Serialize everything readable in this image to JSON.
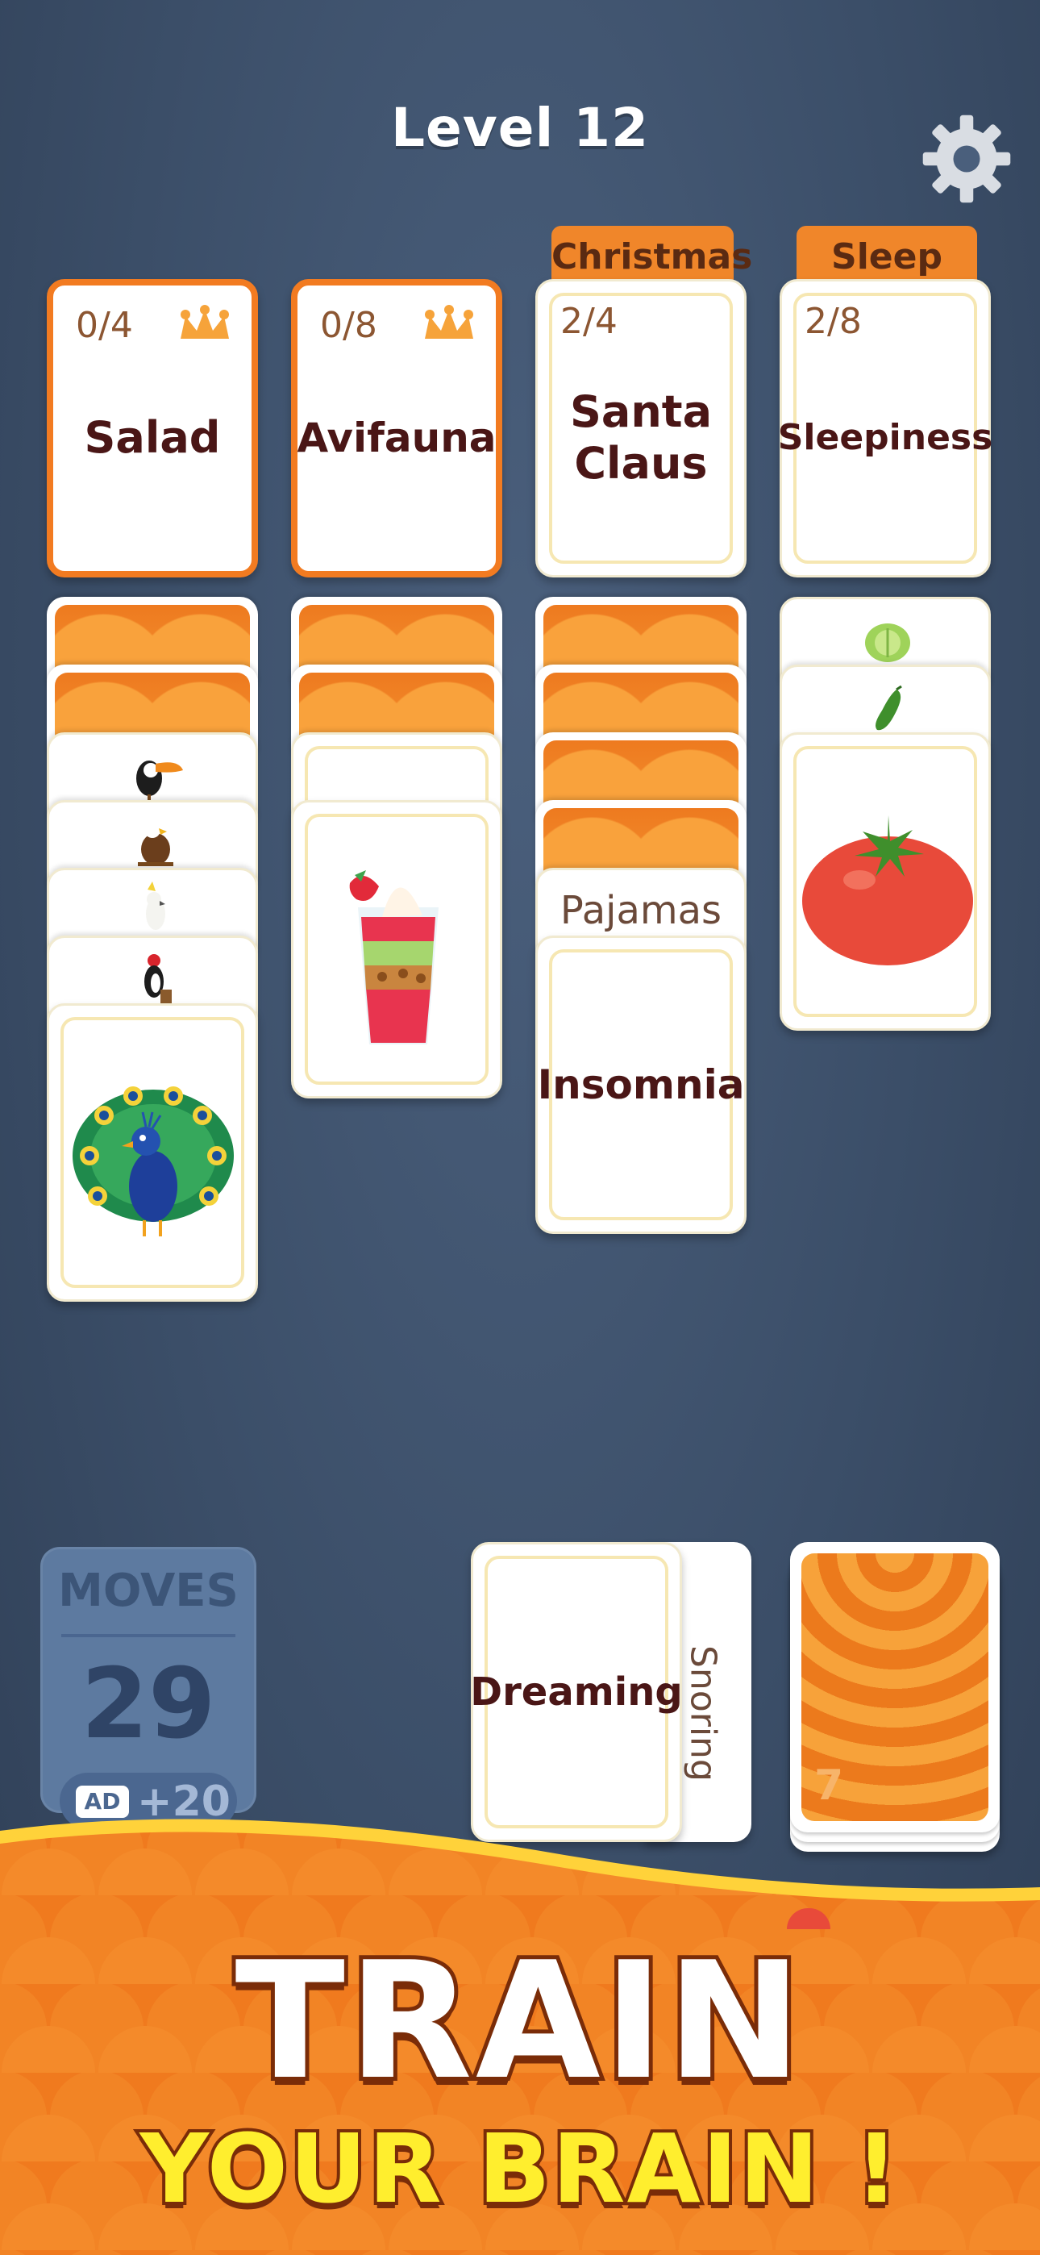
{
  "header": {
    "level": "Level 12"
  },
  "categories": [
    {
      "tab": "",
      "count": "0/4",
      "title": "Salad",
      "complete": false,
      "jester": true
    },
    {
      "tab": "",
      "count": "0/8",
      "title": "Avifauna",
      "complete": false,
      "jester": true
    },
    {
      "tab": "Christmas",
      "count": "2/4",
      "title": "Santa\nClaus",
      "complete": true,
      "jester": false
    },
    {
      "tab": "Sleep",
      "count": "2/8",
      "title": "Sleepiness",
      "complete": true,
      "jester": false
    }
  ],
  "columns": {
    "col1": {
      "face_down": 2,
      "peek_icons": [
        "toucan-icon",
        "eagle-icon",
        "cockatoo-icon",
        "woodpecker-icon"
      ],
      "top_icon": "peacock-icon"
    },
    "col2": {
      "face_down": 2,
      "peek_blank": 1,
      "top_icon": "parfait-icon"
    },
    "col3": {
      "face_down": 4,
      "peek_word": "Pajamas",
      "top_word": "Insomnia"
    },
    "col4": {
      "peek_icons": [
        "lettuce-icon",
        "cucumber-icon"
      ],
      "top_icon": "tomato-icon"
    }
  },
  "moves": {
    "label": "MOVES",
    "value": "29",
    "ad_tag": "AD",
    "ad_bonus": "+20"
  },
  "hand": {
    "top_word": "Dreaming",
    "under_word": "Snoring"
  },
  "deck": {
    "remaining": "7"
  },
  "promo": {
    "line1": "TRAIN",
    "line2": "YOUR BRAIN !"
  },
  "colors": {
    "accent": "#f27b21",
    "card_text": "#4a1616",
    "background": "#3b4e68",
    "promo_yellow": "#ffee2e"
  }
}
